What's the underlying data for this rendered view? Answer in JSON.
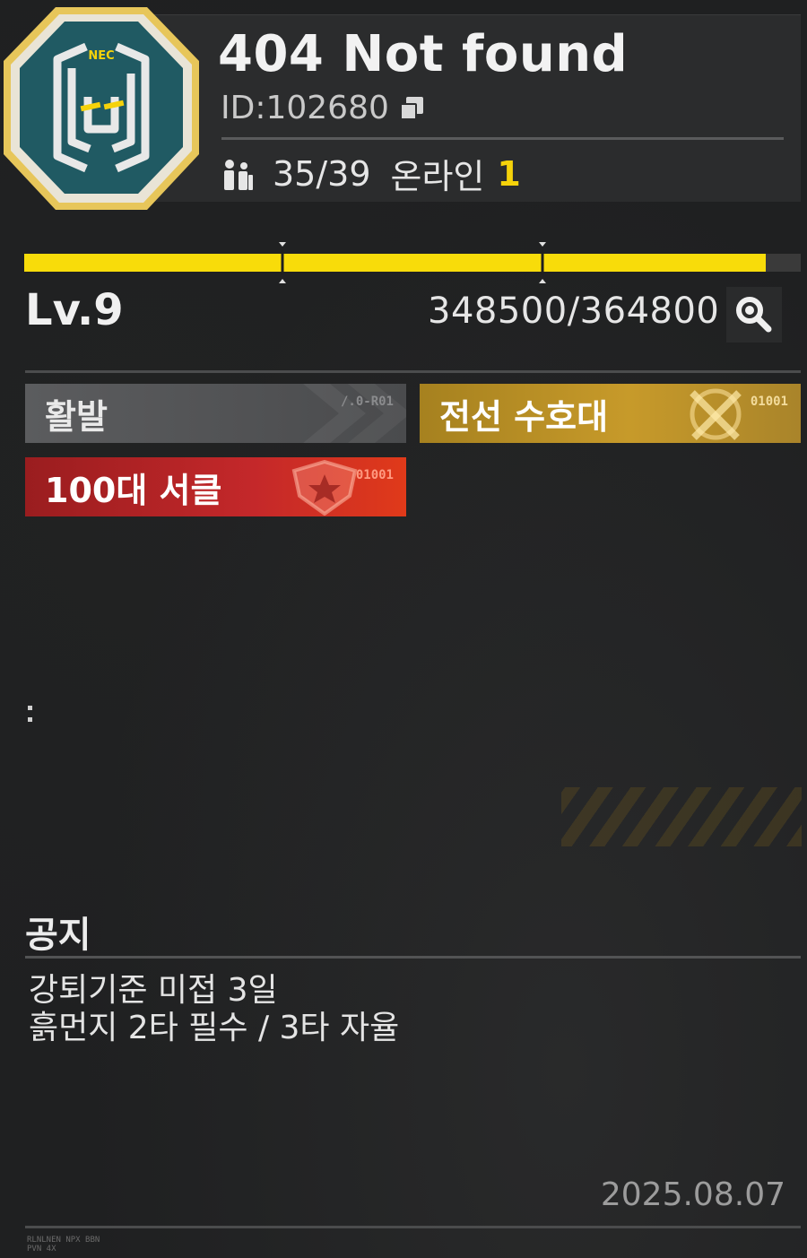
{
  "club": {
    "name": "404 Not found",
    "id_label": "ID:",
    "id_value": "102680",
    "members": "35/39",
    "online_label": "온라인",
    "online_count": "1",
    "emblem_text": "NEC"
  },
  "level": {
    "label": "Lv.9",
    "xp_text": "348500/364800",
    "xp_current": 348500,
    "xp_max": 364800
  },
  "tags": [
    {
      "label": "활발",
      "code": "/.0-R01",
      "style": "gray"
    },
    {
      "label": "전선 수호대",
      "code": "01001",
      "style": "gold"
    },
    {
      "label": "100대 서클",
      "code": "01001",
      "style": "red"
    }
  ],
  "notice": {
    "title": "공지",
    "line1": "강퇴기준 미접 3일",
    "line2": "흙먼지 2타 필수 / 3타 자율",
    "date": "2025.08.07"
  },
  "footer_code": "RLNLNEN NPX BBN\nPVN 4X",
  "colors": {
    "accent_yellow": "#f8dc0a",
    "panel": "#2b2c2d",
    "gold": "#c79a2a",
    "red": "#c4282a"
  },
  "icons": [
    "emblem-icon",
    "copy-icon",
    "members-icon",
    "search-icon"
  ]
}
